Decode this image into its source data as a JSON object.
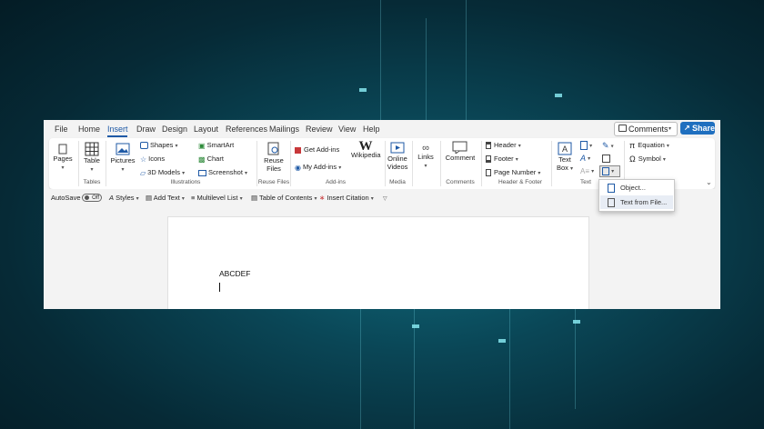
{
  "menu": {
    "tabs": [
      "File",
      "Home",
      "Insert",
      "Draw",
      "Design",
      "Layout",
      "References",
      "Mailings",
      "Review",
      "View",
      "Help"
    ],
    "active_tab": "Insert",
    "comments_label": "Comments",
    "share_label": "Share"
  },
  "ribbon": {
    "pages": {
      "label": "Pages"
    },
    "tables": {
      "table": "Table",
      "group": "Tables"
    },
    "illustrations": {
      "pictures": "Pictures",
      "shapes": "Shapes",
      "icons": "Icons",
      "models": "3D Models",
      "smartart": "SmartArt",
      "chart": "Chart",
      "screenshot": "Screenshot",
      "group": "Illustrations"
    },
    "reuse": {
      "label": "Reuse Files",
      "line1": "Reuse",
      "line2": "Files",
      "group": "Reuse Files"
    },
    "addins": {
      "get": "Get Add-ins",
      "my": "My Add-ins",
      "wikipedia": "Wikipedia",
      "group": "Add-ins"
    },
    "media": {
      "line1": "Online",
      "line2": "Videos",
      "group": "Media"
    },
    "links": {
      "label": "Links"
    },
    "comments": {
      "label": "Comment",
      "group": "Comments"
    },
    "header_footer": {
      "header": "Header",
      "footer": "Footer",
      "page_number": "Page Number",
      "group": "Header & Footer"
    },
    "text": {
      "line1": "Text",
      "line2": "Box",
      "group": "Text"
    },
    "symbols": {
      "equation": "Equation",
      "symbol": "Symbol"
    }
  },
  "toolbar": {
    "autosave": "AutoSave",
    "autosave_state": "Off",
    "styles": "Styles",
    "add_text": "Add Text",
    "multilevel": "Multilevel List",
    "toc": "Table of Contents",
    "citation": "Insert Citation"
  },
  "document": {
    "text": "ABCDEF"
  },
  "object_menu": {
    "items": [
      "Object...",
      "Text from File..."
    ]
  }
}
